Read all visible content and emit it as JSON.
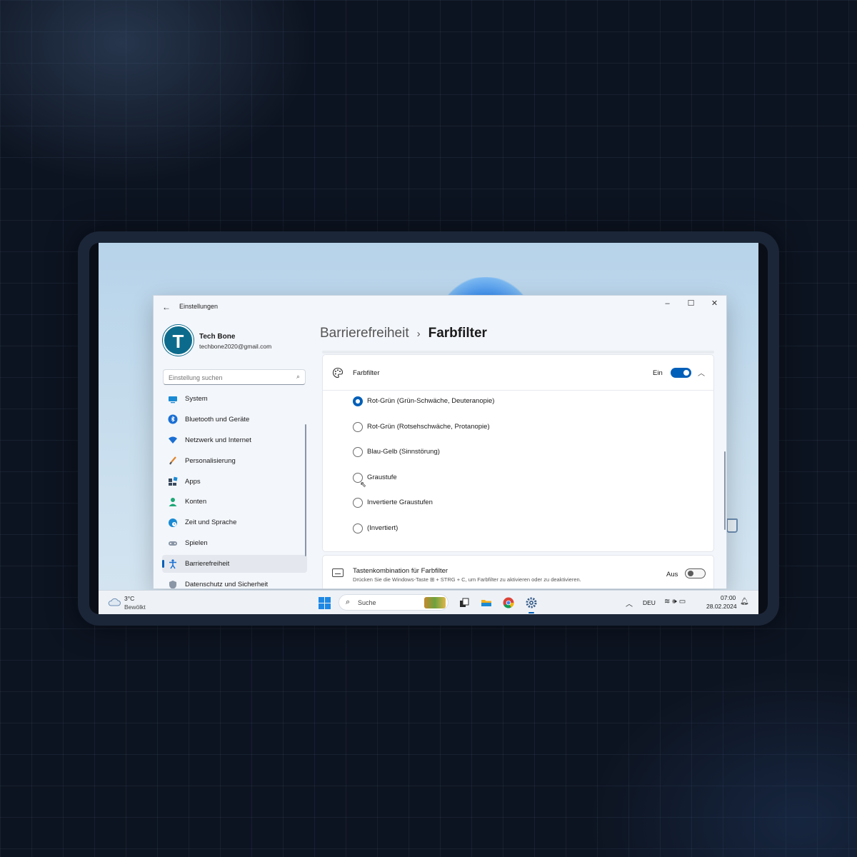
{
  "window": {
    "title": "Einstellungen",
    "back_icon": "arrow-left-icon",
    "controls": [
      "minimize",
      "maximize",
      "close"
    ]
  },
  "profile": {
    "initial": "T",
    "name": "Tech Bone",
    "email": "techbone2020@gmail.com"
  },
  "search": {
    "placeholder": "Einstellung suchen",
    "icon": "search-icon"
  },
  "sidebar": {
    "items": [
      {
        "label": "System",
        "icon": "monitor-icon",
        "active": false
      },
      {
        "label": "Bluetooth und Geräte",
        "icon": "bluetooth-icon",
        "active": false
      },
      {
        "label": "Netzwerk und Internet",
        "icon": "wifi-icon",
        "active": false
      },
      {
        "label": "Personalisierung",
        "icon": "brush-icon",
        "active": false
      },
      {
        "label": "Apps",
        "icon": "apps-icon",
        "active": false
      },
      {
        "label": "Konten",
        "icon": "person-icon",
        "active": false
      },
      {
        "label": "Zeit und Sprache",
        "icon": "globe-clock-icon",
        "active": false
      },
      {
        "label": "Spielen",
        "icon": "gamepad-icon",
        "active": false
      },
      {
        "label": "Barrierefreiheit",
        "icon": "accessibility-icon",
        "active": true
      },
      {
        "label": "Datenschutz und Sicherheit",
        "icon": "shield-icon",
        "active": false
      }
    ]
  },
  "breadcrumb": {
    "parent": "Barrierefreiheit",
    "separator": "›",
    "current": "Farbfilter"
  },
  "farbfilter": {
    "label": "Farbfilter",
    "state_label": "Ein",
    "toggle_on": true,
    "expanded": true,
    "options": [
      {
        "label": "Rot-Grün (Grün-Schwäche, Deuteranopie)",
        "selected": true
      },
      {
        "label": "Rot-Grün (Rotsehschwäche, Protanopie)",
        "selected": false
      },
      {
        "label": "Blau-Gelb (Sinnstörung)",
        "selected": false
      },
      {
        "label": "Graustufe",
        "selected": false
      },
      {
        "label": "Invertierte Graustufen",
        "selected": false
      },
      {
        "label": "(Invertiert)",
        "selected": false
      }
    ]
  },
  "shortcut": {
    "title": "Tastenkombination für Farbfilter",
    "description": "Drücken Sie die Windows-Taste ⊞ + STRG + C, um Farbfilter zu aktivieren oder zu deaktivieren.",
    "state_label": "Aus",
    "toggle_on": false
  },
  "taskbar": {
    "weather_temp": "3°C",
    "weather_condition": "Bewölkt",
    "search_label": "Suche",
    "apps": [
      "windows-start-icon",
      "search-icon",
      "task-view-icon",
      "file-explorer-icon",
      "chrome-icon",
      "settings-icon"
    ],
    "language": "DEU",
    "time": "07:00",
    "date": "28.02.2024"
  },
  "colors": {
    "accent": "#005fb8",
    "window_bg": "#f3f6fb",
    "card_bg": "#ffffff"
  }
}
